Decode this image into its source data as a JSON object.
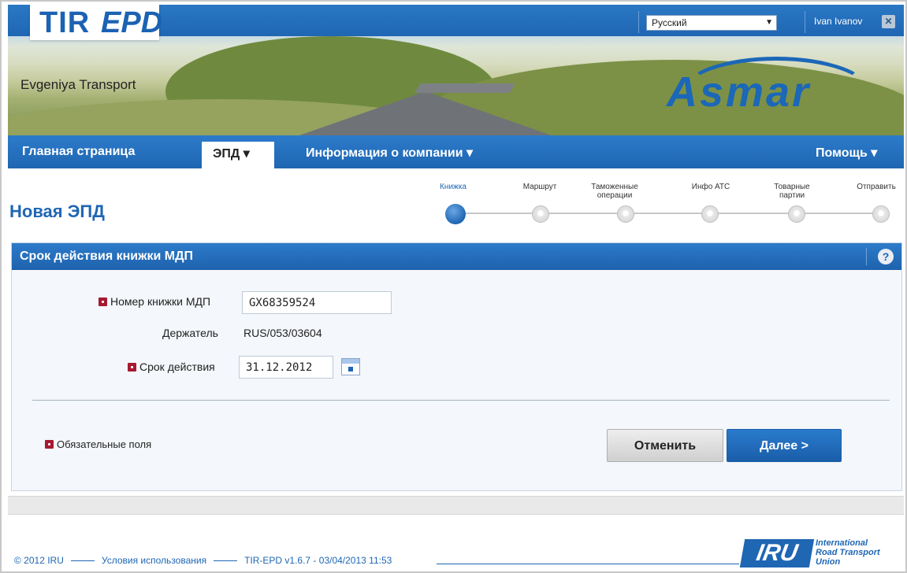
{
  "header": {
    "logo_tir": "TIR",
    "logo_epd": "EPD",
    "language_selected": "Русский",
    "user_name": "Ivan Ivanov",
    "company_name": "Evgeniya Transport",
    "brand_logo": "Asmar"
  },
  "nav": {
    "home": "Главная страница",
    "epd": "ЭПД ▾",
    "company_info": "Информация о компании ▾",
    "help": "Помощь ▾"
  },
  "page": {
    "title": "Новая ЭПД"
  },
  "steps": [
    {
      "label": "Книжка",
      "active": true
    },
    {
      "label": "Маршрут",
      "active": false
    },
    {
      "label": "Таможенные операции",
      "active": false
    },
    {
      "label": "Инфо АТС",
      "active": false
    },
    {
      "label": "Товарные партии",
      "active": false
    },
    {
      "label": "Отправить",
      "active": false
    }
  ],
  "panel": {
    "title": "Срок действия книжки МДП",
    "help": "?",
    "fields": {
      "book_number_label": "Номер книжки МДП",
      "book_number_value": "GX68359524",
      "holder_label": "Держатель",
      "holder_value": "RUS/053/03604",
      "validity_label": "Срок действия",
      "validity_value": "31.12.2012"
    },
    "required_note": "Обязательные поля",
    "cancel_label": "Отменить",
    "next_label": "Далее >"
  },
  "footer": {
    "copyright": "© 2012 IRU",
    "terms": "Условия использования",
    "version": "TIR-EPD v1.6.7 - 03/04/2013 11:53",
    "iru_logo": "IRU",
    "iru_line1": "International",
    "iru_line2": "Road Transport",
    "iru_line3": "Union"
  },
  "colors": {
    "primary": "#1f66b3",
    "required": "#a71930"
  }
}
